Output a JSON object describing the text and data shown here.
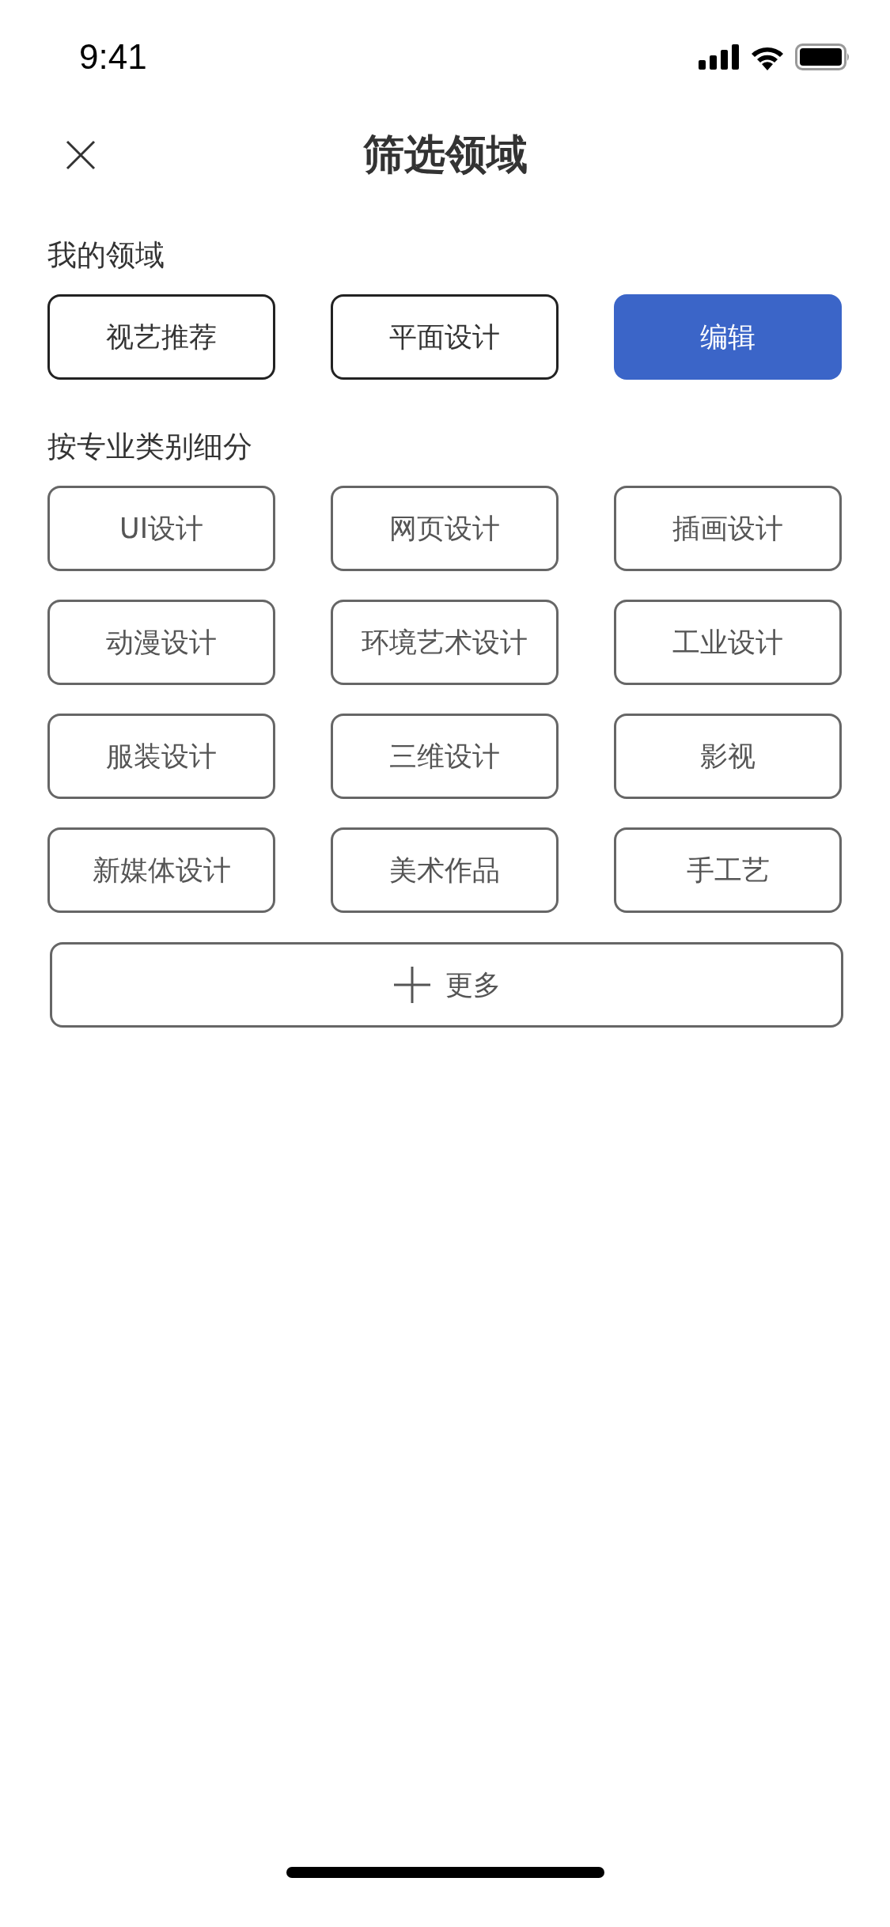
{
  "status_bar": {
    "time": "9:41"
  },
  "header": {
    "title": "筛选领域"
  },
  "my_fields": {
    "label": "我的领域",
    "items": [
      "视艺推荐",
      "平面设计"
    ],
    "edit_button": "编辑"
  },
  "categories": {
    "label": "按专业类别细分",
    "items": [
      "UI设计",
      "网页设计",
      "插画设计",
      "动漫设计",
      "环境艺术设计",
      "工业设计",
      "服装设计",
      "三维设计",
      "影视",
      "新媒体设计",
      "美术作品",
      "手工艺"
    ],
    "more_button": "更多"
  }
}
